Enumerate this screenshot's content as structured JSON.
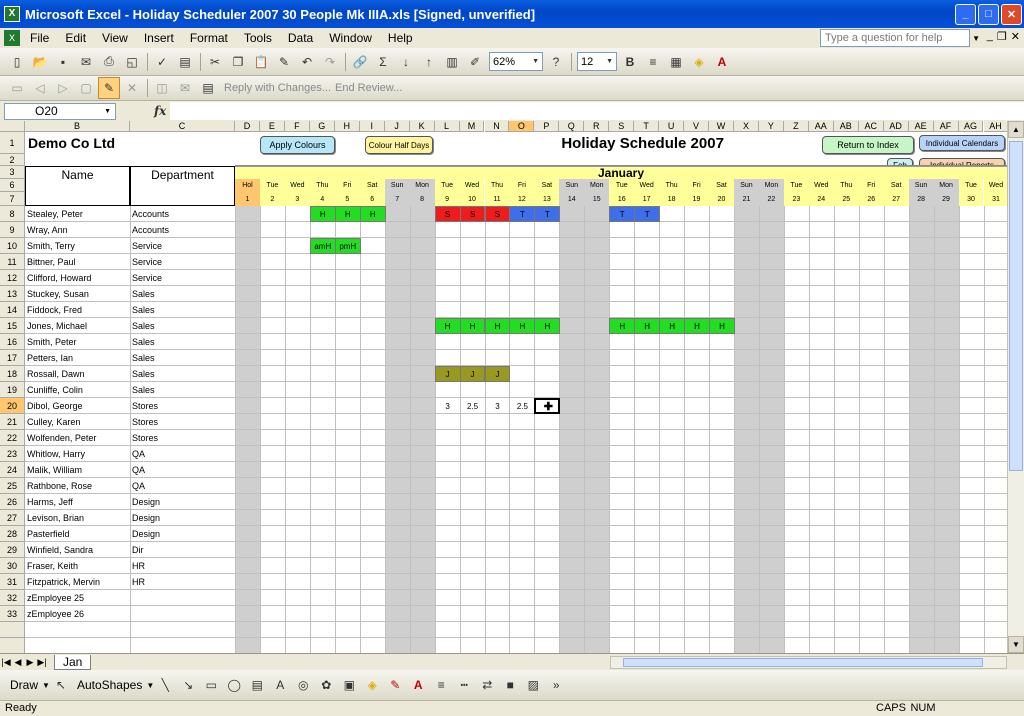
{
  "window": {
    "title": "Microsoft Excel - Holiday Scheduler 2007 30 People Mk IIIA.xls  [Signed, unverified]"
  },
  "menu": [
    "File",
    "Edit",
    "View",
    "Insert",
    "Format",
    "Tools",
    "Data",
    "Window",
    "Help"
  ],
  "help_placeholder": "Type a question for help",
  "toolbar": {
    "zoom": "62%",
    "font_size": "12",
    "reply_label": "Reply with Changes...",
    "end_review_label": "End Review..."
  },
  "formula_bar": {
    "name_box": "O20",
    "fx": "fx"
  },
  "sheet": {
    "columns": [
      "B",
      "C",
      "D",
      "E",
      "F",
      "G",
      "H",
      "I",
      "J",
      "K",
      "L",
      "M",
      "N",
      "O",
      "P",
      "Q",
      "R",
      "S",
      "T",
      "U",
      "V",
      "W",
      "X",
      "Y",
      "Z",
      "AA",
      "AB",
      "AC",
      "AD",
      "AE",
      "AF",
      "AG",
      "AH"
    ],
    "selected_column": "O",
    "selected_row": "20",
    "row_numbers": [
      "1",
      "2",
      "3",
      "6",
      "7",
      "8",
      "9",
      "10",
      "11",
      "12",
      "13",
      "14",
      "15",
      "16",
      "17",
      "18",
      "19",
      "20",
      "21",
      "22",
      "23",
      "24",
      "25",
      "26",
      "27",
      "28",
      "29",
      "30",
      "31",
      "32",
      "33"
    ],
    "company": "Demo Co Ltd",
    "schedule_title": "Holiday Schedule 2007",
    "month": "January",
    "name_header": "Name",
    "department_header": "Department",
    "hol_label": "Hol",
    "days": [
      "Tue",
      "Wed",
      "Thu",
      "Fri",
      "Sat",
      "Sun",
      "Mon",
      "Tue",
      "Wed",
      "Thu",
      "Fri",
      "Sat",
      "Sun",
      "Mon",
      "Tue",
      "Wed",
      "Thu",
      "Fri",
      "Sat",
      "Sun",
      "Mon",
      "Tue",
      "Wed",
      "Thu",
      "Fri",
      "Sat",
      "Sun",
      "Mon",
      "Tue",
      "Wed"
    ],
    "dates": [
      "1",
      "2",
      "3",
      "4",
      "5",
      "6",
      "7",
      "8",
      "9",
      "10",
      "11",
      "12",
      "13",
      "14",
      "15",
      "16",
      "17",
      "18",
      "19",
      "20",
      "21",
      "22",
      "23",
      "24",
      "25",
      "26",
      "27",
      "28",
      "29",
      "30",
      "31"
    ],
    "employees": [
      {
        "name": "Stealey, Peter",
        "dept": "Accounts"
      },
      {
        "name": "Wray, Ann",
        "dept": "Accounts"
      },
      {
        "name": "Smith, Terry",
        "dept": "Service"
      },
      {
        "name": "Bittner, Paul",
        "dept": "Service"
      },
      {
        "name": "Clifford, Howard",
        "dept": "Service"
      },
      {
        "name": "Stuckey, Susan",
        "dept": "Sales"
      },
      {
        "name": "Fiddock, Fred",
        "dept": "Sales"
      },
      {
        "name": "Jones, Michael",
        "dept": "Sales"
      },
      {
        "name": "Smith, Peter",
        "dept": "Sales"
      },
      {
        "name": "Petters, Ian",
        "dept": "Sales"
      },
      {
        "name": "Rossall, Dawn",
        "dept": "Sales"
      },
      {
        "name": "Cunliffe, Colin",
        "dept": "Sales"
      },
      {
        "name": "Dibol, George",
        "dept": "Stores"
      },
      {
        "name": "Culley, Karen",
        "dept": "Stores"
      },
      {
        "name": "Wolfenden, Peter",
        "dept": "Stores"
      },
      {
        "name": "Whitlow, Harry",
        "dept": "QA"
      },
      {
        "name": "Malik, William",
        "dept": "QA"
      },
      {
        "name": "Rathbone, Rose",
        "dept": "QA"
      },
      {
        "name": "Harms, Jeff",
        "dept": "Design"
      },
      {
        "name": "Levison, Brian",
        "dept": "Design"
      },
      {
        "name": "Pasterfield",
        "dept": "Design"
      },
      {
        "name": "Winfield, Sandra",
        "dept": "Dir"
      },
      {
        "name": "Fraser, Keith",
        "dept": "HR"
      },
      {
        "name": "Fitzpatrick, Mervin",
        "dept": "HR"
      },
      {
        "name": "zEmployee 25",
        "dept": ""
      },
      {
        "name": "zEmployee 26",
        "dept": ""
      }
    ],
    "bookings": [
      {
        "row": 0,
        "day": 3,
        "text": "H",
        "color": "#22dd22"
      },
      {
        "row": 0,
        "day": 4,
        "text": "H",
        "color": "#22dd22"
      },
      {
        "row": 0,
        "day": 5,
        "text": "H",
        "color": "#22dd22"
      },
      {
        "row": 0,
        "day": 8,
        "text": "S",
        "color": "#ee1c1c"
      },
      {
        "row": 0,
        "day": 9,
        "text": "S",
        "color": "#ee1c1c"
      },
      {
        "row": 0,
        "day": 10,
        "text": "S",
        "color": "#ee1c1c"
      },
      {
        "row": 0,
        "day": 11,
        "text": "T",
        "color": "#3f6fe8"
      },
      {
        "row": 0,
        "day": 12,
        "text": "T",
        "color": "#3f6fe8"
      },
      {
        "row": 0,
        "day": 15,
        "text": "T",
        "color": "#3f6fe8"
      },
      {
        "row": 0,
        "day": 16,
        "text": "T",
        "color": "#3f6fe8"
      },
      {
        "row": 2,
        "day": 3,
        "text": "amH",
        "color": "#22dd22"
      },
      {
        "row": 2,
        "day": 4,
        "text": "pmH",
        "color": "#22dd22"
      },
      {
        "row": 7,
        "day": 8,
        "text": "H",
        "color": "#22dd22"
      },
      {
        "row": 7,
        "day": 9,
        "text": "H",
        "color": "#22dd22"
      },
      {
        "row": 7,
        "day": 10,
        "text": "H",
        "color": "#22dd22"
      },
      {
        "row": 7,
        "day": 11,
        "text": "H",
        "color": "#22dd22"
      },
      {
        "row": 7,
        "day": 12,
        "text": "H",
        "color": "#22dd22"
      },
      {
        "row": 7,
        "day": 15,
        "text": "H",
        "color": "#22dd22"
      },
      {
        "row": 7,
        "day": 16,
        "text": "H",
        "color": "#22dd22"
      },
      {
        "row": 7,
        "day": 17,
        "text": "H",
        "color": "#22dd22"
      },
      {
        "row": 7,
        "day": 18,
        "text": "H",
        "color": "#22dd22"
      },
      {
        "row": 7,
        "day": 19,
        "text": "H",
        "color": "#22dd22"
      },
      {
        "row": 10,
        "day": 8,
        "text": "J",
        "color": "#999922"
      },
      {
        "row": 10,
        "day": 9,
        "text": "J",
        "color": "#999922"
      },
      {
        "row": 10,
        "day": 10,
        "text": "J",
        "color": "#999922"
      },
      {
        "row": 12,
        "day": 8,
        "text": "3",
        "color": ""
      },
      {
        "row": 12,
        "day": 9,
        "text": "2.5",
        "color": ""
      },
      {
        "row": 12,
        "day": 10,
        "text": "3",
        "color": ""
      },
      {
        "row": 12,
        "day": 11,
        "text": "2.5",
        "color": ""
      }
    ],
    "buttons": {
      "apply_colours": "Apply Colours",
      "colour_half_days": "Colour Half Days",
      "return_to_index": "Return to Index",
      "individual_calendars": "Individual Calendars",
      "feb": "Feb",
      "individual_reports": "Individual Reports"
    },
    "colors": {
      "weekend": "#cfcfcf",
      "hol": "#ffc66e",
      "weekday_header": "#ffff99",
      "month_band": "#ffff99"
    }
  },
  "tabs": {
    "active": "Jan"
  },
  "drawbar": {
    "draw": "Draw",
    "autoshapes": "AutoShapes"
  },
  "status": {
    "text": "Ready",
    "caps": "CAPS",
    "num": "NUM"
  }
}
